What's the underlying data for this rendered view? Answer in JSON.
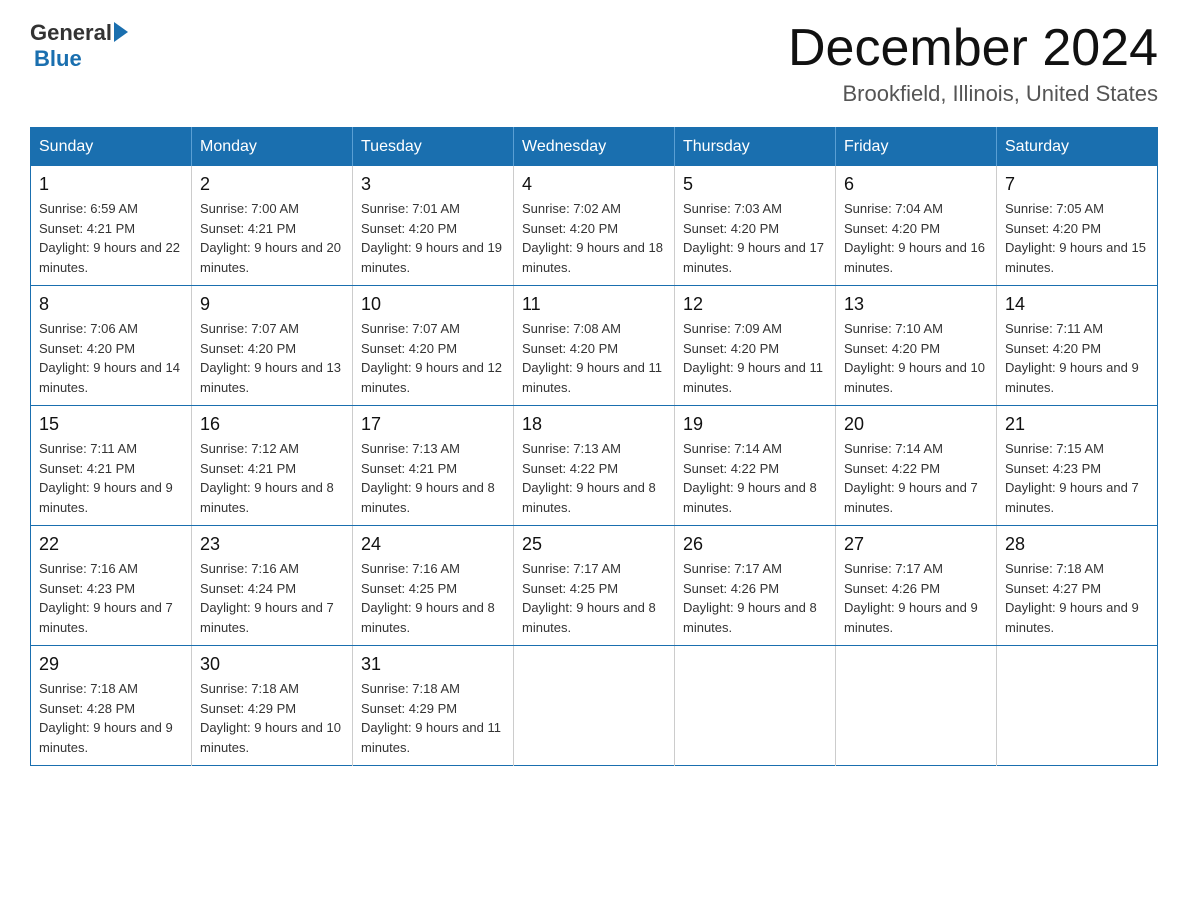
{
  "logo": {
    "general": "General",
    "blue": "Blue"
  },
  "header": {
    "month": "December 2024",
    "location": "Brookfield, Illinois, United States"
  },
  "days_of_week": [
    "Sunday",
    "Monday",
    "Tuesday",
    "Wednesday",
    "Thursday",
    "Friday",
    "Saturday"
  ],
  "weeks": [
    [
      {
        "day": "1",
        "sunrise": "6:59 AM",
        "sunset": "4:21 PM",
        "daylight": "9 hours and 22 minutes."
      },
      {
        "day": "2",
        "sunrise": "7:00 AM",
        "sunset": "4:21 PM",
        "daylight": "9 hours and 20 minutes."
      },
      {
        "day": "3",
        "sunrise": "7:01 AM",
        "sunset": "4:20 PM",
        "daylight": "9 hours and 19 minutes."
      },
      {
        "day": "4",
        "sunrise": "7:02 AM",
        "sunset": "4:20 PM",
        "daylight": "9 hours and 18 minutes."
      },
      {
        "day": "5",
        "sunrise": "7:03 AM",
        "sunset": "4:20 PM",
        "daylight": "9 hours and 17 minutes."
      },
      {
        "day": "6",
        "sunrise": "7:04 AM",
        "sunset": "4:20 PM",
        "daylight": "9 hours and 16 minutes."
      },
      {
        "day": "7",
        "sunrise": "7:05 AM",
        "sunset": "4:20 PM",
        "daylight": "9 hours and 15 minutes."
      }
    ],
    [
      {
        "day": "8",
        "sunrise": "7:06 AM",
        "sunset": "4:20 PM",
        "daylight": "9 hours and 14 minutes."
      },
      {
        "day": "9",
        "sunrise": "7:07 AM",
        "sunset": "4:20 PM",
        "daylight": "9 hours and 13 minutes."
      },
      {
        "day": "10",
        "sunrise": "7:07 AM",
        "sunset": "4:20 PM",
        "daylight": "9 hours and 12 minutes."
      },
      {
        "day": "11",
        "sunrise": "7:08 AM",
        "sunset": "4:20 PM",
        "daylight": "9 hours and 11 minutes."
      },
      {
        "day": "12",
        "sunrise": "7:09 AM",
        "sunset": "4:20 PM",
        "daylight": "9 hours and 11 minutes."
      },
      {
        "day": "13",
        "sunrise": "7:10 AM",
        "sunset": "4:20 PM",
        "daylight": "9 hours and 10 minutes."
      },
      {
        "day": "14",
        "sunrise": "7:11 AM",
        "sunset": "4:20 PM",
        "daylight": "9 hours and 9 minutes."
      }
    ],
    [
      {
        "day": "15",
        "sunrise": "7:11 AM",
        "sunset": "4:21 PM",
        "daylight": "9 hours and 9 minutes."
      },
      {
        "day": "16",
        "sunrise": "7:12 AM",
        "sunset": "4:21 PM",
        "daylight": "9 hours and 8 minutes."
      },
      {
        "day": "17",
        "sunrise": "7:13 AM",
        "sunset": "4:21 PM",
        "daylight": "9 hours and 8 minutes."
      },
      {
        "day": "18",
        "sunrise": "7:13 AM",
        "sunset": "4:22 PM",
        "daylight": "9 hours and 8 minutes."
      },
      {
        "day": "19",
        "sunrise": "7:14 AM",
        "sunset": "4:22 PM",
        "daylight": "9 hours and 8 minutes."
      },
      {
        "day": "20",
        "sunrise": "7:14 AM",
        "sunset": "4:22 PM",
        "daylight": "9 hours and 7 minutes."
      },
      {
        "day": "21",
        "sunrise": "7:15 AM",
        "sunset": "4:23 PM",
        "daylight": "9 hours and 7 minutes."
      }
    ],
    [
      {
        "day": "22",
        "sunrise": "7:16 AM",
        "sunset": "4:23 PM",
        "daylight": "9 hours and 7 minutes."
      },
      {
        "day": "23",
        "sunrise": "7:16 AM",
        "sunset": "4:24 PM",
        "daylight": "9 hours and 7 minutes."
      },
      {
        "day": "24",
        "sunrise": "7:16 AM",
        "sunset": "4:25 PM",
        "daylight": "9 hours and 8 minutes."
      },
      {
        "day": "25",
        "sunrise": "7:17 AM",
        "sunset": "4:25 PM",
        "daylight": "9 hours and 8 minutes."
      },
      {
        "day": "26",
        "sunrise": "7:17 AM",
        "sunset": "4:26 PM",
        "daylight": "9 hours and 8 minutes."
      },
      {
        "day": "27",
        "sunrise": "7:17 AM",
        "sunset": "4:26 PM",
        "daylight": "9 hours and 9 minutes."
      },
      {
        "day": "28",
        "sunrise": "7:18 AM",
        "sunset": "4:27 PM",
        "daylight": "9 hours and 9 minutes."
      }
    ],
    [
      {
        "day": "29",
        "sunrise": "7:18 AM",
        "sunset": "4:28 PM",
        "daylight": "9 hours and 9 minutes."
      },
      {
        "day": "30",
        "sunrise": "7:18 AM",
        "sunset": "4:29 PM",
        "daylight": "9 hours and 10 minutes."
      },
      {
        "day": "31",
        "sunrise": "7:18 AM",
        "sunset": "4:29 PM",
        "daylight": "9 hours and 11 minutes."
      },
      null,
      null,
      null,
      null
    ]
  ]
}
